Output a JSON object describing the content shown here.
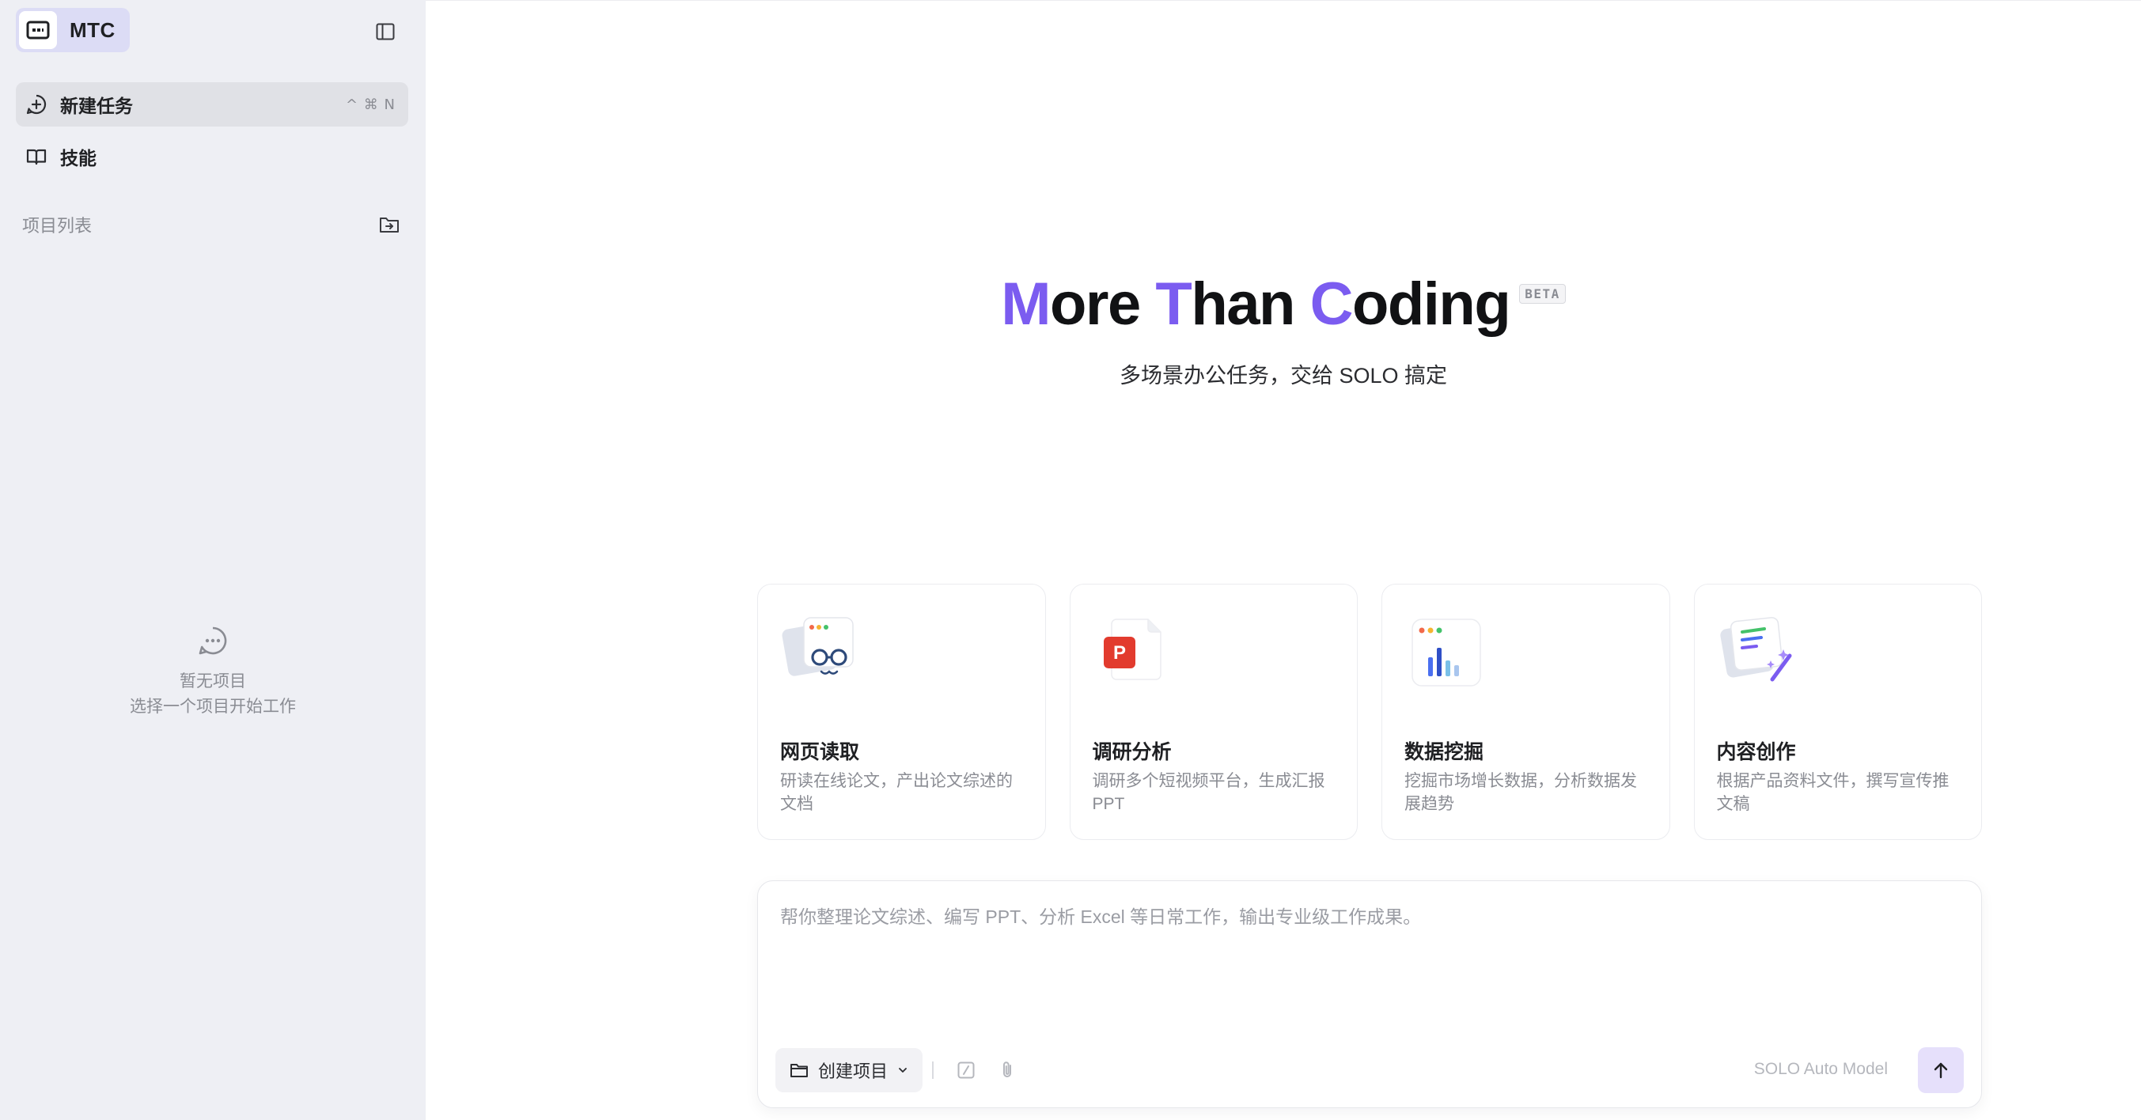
{
  "brand": {
    "name": "MTC",
    "icon": "terminal-logo-icon"
  },
  "sidebar": {
    "toggle_icon": "sidebar-panel-icon",
    "nav": [
      {
        "label": "新建任务",
        "icon": "plus-circle-icon",
        "shortcut": "^ ⌘ N",
        "active": true
      },
      {
        "label": "技能",
        "icon": "book-open-icon",
        "shortcut": "",
        "active": false
      }
    ],
    "projects_title": "项目列表",
    "projects_action_icon": "folder-plus-icon",
    "empty": {
      "icon": "chat-bubble-icon",
      "title": "暂无项目",
      "subtitle": "选择一个项目开始工作"
    }
  },
  "hero": {
    "title_parts": [
      {
        "text": "M",
        "accent": true
      },
      {
        "text": "ore ",
        "accent": false
      },
      {
        "text": "T",
        "accent": true
      },
      {
        "text": "han ",
        "accent": false
      },
      {
        "text": "C",
        "accent": true
      },
      {
        "text": "oding",
        "accent": false
      }
    ],
    "badge": "BETA",
    "subtitle": "多场景办公任务，交给 SOLO 搞定",
    "accent_color": "#7b5cf0"
  },
  "cards": [
    {
      "title": "网页读取",
      "desc": "研读在线论文，产出论文综述的文档",
      "icon": "web-reader-icon"
    },
    {
      "title": "调研分析",
      "desc": "调研多个短视频平台，生成汇报PPT",
      "icon": "ppt-document-icon"
    },
    {
      "title": "数据挖掘",
      "desc": "挖掘市场增长数据，分析数据发展趋势",
      "icon": "bar-chart-icon"
    },
    {
      "title": "内容创作",
      "desc": "根据产品资料文件，撰写宣传推文稿",
      "icon": "content-writing-icon"
    }
  ],
  "composer": {
    "placeholder": "帮你整理论文综述、编写 PPT、分析 Excel 等日常工作，输出专业级工作成果。",
    "project_picker": {
      "label": "创建项目",
      "icon": "folder-icon",
      "chevron": "chevron-down-icon"
    },
    "tools": [
      "slash-command-icon",
      "paperclip-icon"
    ],
    "model": "SOLO Auto Model",
    "send_icon": "arrow-up-icon"
  }
}
